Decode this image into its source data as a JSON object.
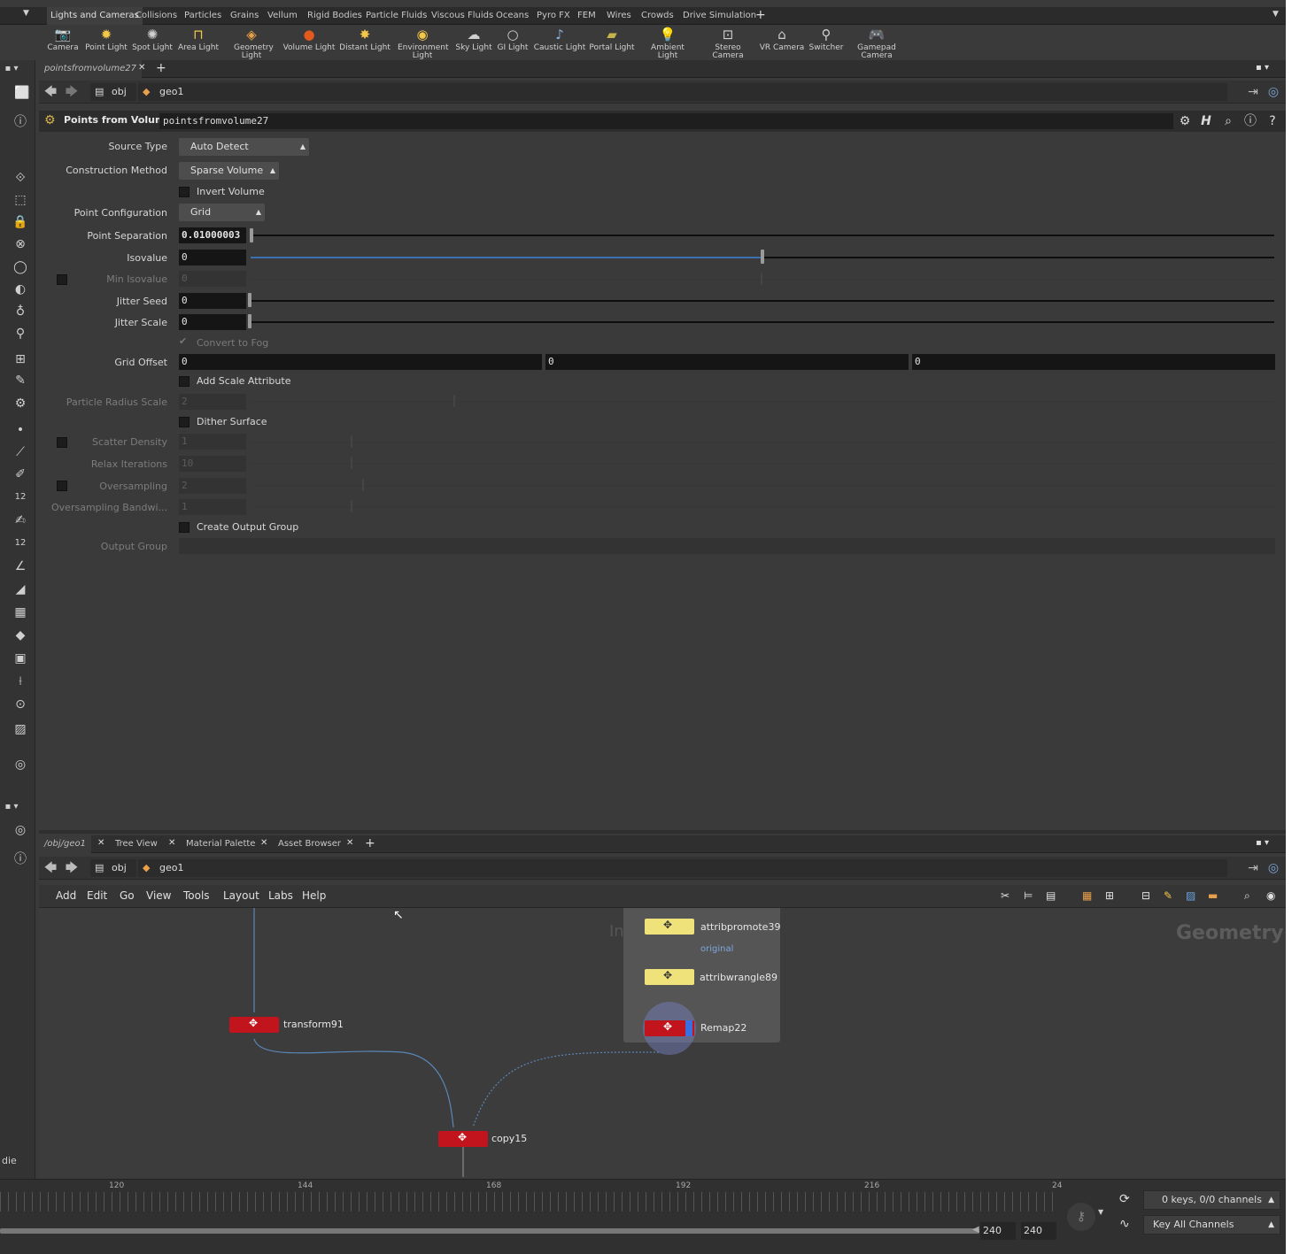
{
  "shelf": {
    "tabs": [
      "Lights and Cameras",
      "Collisions",
      "Particles",
      "Grains",
      "Vellum",
      "Rigid Bodies",
      "Particle Fluids",
      "Viscous Fluids",
      "Oceans",
      "Pyro FX",
      "FEM",
      "Wires",
      "Crowds",
      "Drive Simulation"
    ],
    "tools": [
      {
        "label": "Camera",
        "icon": "camera-icon",
        "glyph": "📷"
      },
      {
        "label": "Point Light",
        "icon": "point-light-icon",
        "glyph": "✹"
      },
      {
        "label": "Spot Light",
        "icon": "spot-light-icon",
        "glyph": "✺"
      },
      {
        "label": "Area Light",
        "icon": "area-light-icon",
        "glyph": "⊓"
      },
      {
        "label": "Geometry Light",
        "icon": "geometry-light-icon",
        "glyph": "◈"
      },
      {
        "label": "Volume Light",
        "icon": "volume-light-icon",
        "glyph": "●"
      },
      {
        "label": "Distant Light",
        "icon": "distant-light-icon",
        "glyph": "✸"
      },
      {
        "label": "Environment Light",
        "icon": "environment-light-icon",
        "glyph": "◉"
      },
      {
        "label": "Sky Light",
        "icon": "sky-light-icon",
        "glyph": "☁"
      },
      {
        "label": "GI Light",
        "icon": "gi-light-icon",
        "glyph": "○"
      },
      {
        "label": "Caustic Light",
        "icon": "caustic-light-icon",
        "glyph": "♪"
      },
      {
        "label": "Portal Light",
        "icon": "portal-light-icon",
        "glyph": "▰"
      },
      {
        "label": "Ambient Light",
        "icon": "ambient-light-icon",
        "glyph": "💡"
      },
      {
        "label": "Stereo Camera",
        "icon": "stereo-camera-icon",
        "glyph": "⊡"
      },
      {
        "label": "VR Camera",
        "icon": "vr-camera-icon",
        "glyph": "⌂"
      },
      {
        "label": "Switcher",
        "icon": "switcher-icon",
        "glyph": "⚲"
      },
      {
        "label": "Gamepad Camera",
        "icon": "gamepad-camera-icon",
        "glyph": "🎮"
      }
    ]
  },
  "param_pane": {
    "tab": "pointsfromvolume27",
    "path": {
      "root": "obj",
      "node": "geo1"
    },
    "node_type": "Points from Volume",
    "node_name": "pointsfromvolume27",
    "params": {
      "source_type": {
        "label": "Source Type",
        "value": "Auto Detect"
      },
      "construction_method": {
        "label": "Construction Method",
        "value": "Sparse Volume"
      },
      "invert_volume": {
        "label": "Invert Volume"
      },
      "point_configuration": {
        "label": "Point Configuration",
        "value": "Grid"
      },
      "point_separation": {
        "label": "Point Separation",
        "value": "0.01000003"
      },
      "isovalue": {
        "label": "Isovalue",
        "value": "0",
        "slider_fraction": 0.5
      },
      "min_isovalue": {
        "label": "Min Isovalue",
        "value": "0"
      },
      "jitter_seed": {
        "label": "Jitter Seed",
        "value": "0"
      },
      "jitter_scale": {
        "label": "Jitter Scale",
        "value": "0"
      },
      "convert_to_fog": {
        "label": "Convert to Fog"
      },
      "grid_offset": {
        "label": "Grid Offset",
        "values": [
          "0",
          "0",
          "0"
        ]
      },
      "add_scale_attribute": {
        "label": "Add Scale Attribute"
      },
      "particle_radius_scale": {
        "label": "Particle Radius Scale",
        "value": "2"
      },
      "dither_surface": {
        "label": "Dither Surface"
      },
      "scatter_density": {
        "label": "Scatter Density",
        "value": "1"
      },
      "relax_iterations": {
        "label": "Relax Iterations",
        "value": "10"
      },
      "oversampling": {
        "label": "Oversampling",
        "value": "2"
      },
      "oversampling_bandwidth": {
        "label": "Oversampling Bandwi...",
        "value": "1"
      },
      "create_output_group": {
        "label": "Create Output Group"
      },
      "output_group": {
        "label": "Output Group",
        "value": ""
      }
    }
  },
  "network_pane": {
    "tabs": [
      "/obj/geo1",
      "Tree View",
      "Material Palette",
      "Asset Browser"
    ],
    "path": {
      "root": "obj",
      "node": "geo1"
    },
    "menu": [
      "Add",
      "Edit",
      "Go",
      "View",
      "Tools",
      "Layout",
      "Labs",
      "Help"
    ],
    "context_label": "Geometry",
    "ghost_text": "Indi",
    "nodes": {
      "transform": "transform91",
      "copy": "copy15",
      "attribpromote": "attribpromote39",
      "attribpromote_comment": "original",
      "attribwrangle": "attribwrangle89",
      "remap": "Remap22"
    }
  },
  "timeline": {
    "ticks": [
      "120",
      "144",
      "168",
      "192",
      "216",
      "24"
    ],
    "end_frame": "240",
    "end_frame2": "240",
    "keys_info": "0 keys, 0/0 channels",
    "key_mode": "Key All Channels"
  },
  "left_panel": {
    "fragment_text": "die"
  },
  "colors": {
    "node_red": "#c2141c",
    "node_yellow": "#efe27a",
    "wire_blue": "#5a86b8",
    "isovalue_slider": "#3a6fb0"
  }
}
